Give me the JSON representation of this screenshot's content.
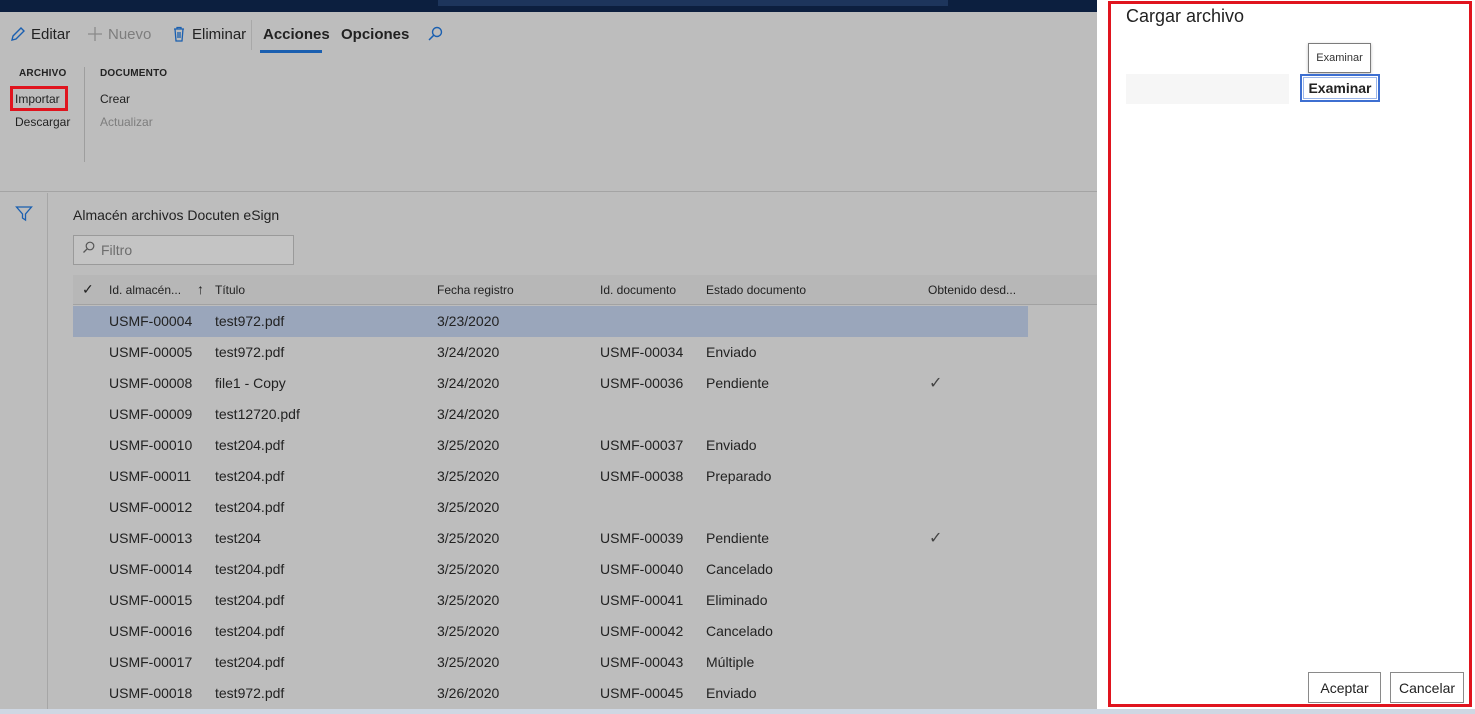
{
  "toolbar": {
    "editar": "Editar",
    "nuevo": "Nuevo",
    "eliminar": "Eliminar",
    "acciones": "Acciones",
    "opciones": "Opciones"
  },
  "ribbon": {
    "archivo_header": "ARCHIVO",
    "importar": "Importar",
    "descargar": "Descargar",
    "documento_header": "DOCUMENTO",
    "crear": "Crear",
    "actualizar": "Actualizar"
  },
  "grid": {
    "title": "Almacén archivos Docuten eSign",
    "filter_placeholder": "Filtro",
    "columns": [
      "Id. almacén...",
      "Título",
      "Fecha registro",
      "Id. documento",
      "Estado documento",
      "Obtenido desd..."
    ],
    "rows": [
      {
        "id": "USMF-00004",
        "titulo": "test972.pdf",
        "fecha": "3/23/2020",
        "doc": "",
        "estado": "",
        "obtenido": false
      },
      {
        "id": "USMF-00005",
        "titulo": "test972.pdf",
        "fecha": "3/24/2020",
        "doc": "USMF-00034",
        "estado": "Enviado",
        "obtenido": false
      },
      {
        "id": "USMF-00008",
        "titulo": "file1 - Copy",
        "fecha": "3/24/2020",
        "doc": "USMF-00036",
        "estado": "Pendiente",
        "obtenido": true
      },
      {
        "id": "USMF-00009",
        "titulo": "test12720.pdf",
        "fecha": "3/24/2020",
        "doc": "",
        "estado": "",
        "obtenido": false
      },
      {
        "id": "USMF-00010",
        "titulo": "test204.pdf",
        "fecha": "3/25/2020",
        "doc": "USMF-00037",
        "estado": "Enviado",
        "obtenido": false
      },
      {
        "id": "USMF-00011",
        "titulo": "test204.pdf",
        "fecha": "3/25/2020",
        "doc": "USMF-00038",
        "estado": "Preparado",
        "obtenido": false
      },
      {
        "id": "USMF-00012",
        "titulo": "test204.pdf",
        "fecha": "3/25/2020",
        "doc": "",
        "estado": "",
        "obtenido": false
      },
      {
        "id": "USMF-00013",
        "titulo": "test204",
        "fecha": "3/25/2020",
        "doc": "USMF-00039",
        "estado": "Pendiente",
        "obtenido": true
      },
      {
        "id": "USMF-00014",
        "titulo": "test204.pdf",
        "fecha": "3/25/2020",
        "doc": "USMF-00040",
        "estado": "Cancelado",
        "obtenido": false
      },
      {
        "id": "USMF-00015",
        "titulo": "test204.pdf",
        "fecha": "3/25/2020",
        "doc": "USMF-00041",
        "estado": "Eliminado",
        "obtenido": false
      },
      {
        "id": "USMF-00016",
        "titulo": "test204.pdf",
        "fecha": "3/25/2020",
        "doc": "USMF-00042",
        "estado": "Cancelado",
        "obtenido": false
      },
      {
        "id": "USMF-00017",
        "titulo": "test204.pdf",
        "fecha": "3/25/2020",
        "doc": "USMF-00043",
        "estado": "Múltiple",
        "obtenido": false
      },
      {
        "id": "USMF-00018",
        "titulo": "test972.pdf",
        "fecha": "3/26/2020",
        "doc": "USMF-00045",
        "estado": "Enviado",
        "obtenido": false
      }
    ]
  },
  "panel": {
    "title": "Cargar archivo",
    "tooltip": "Examinar",
    "examinar": "Examinar",
    "aceptar": "Aceptar",
    "cancelar": "Cancelar"
  },
  "colors": {
    "highlight_border": "#e0141e",
    "selected_row": "#9aa6bb",
    "active_tab": "#1a5fb0",
    "focus_button": "#3d6fd1"
  }
}
